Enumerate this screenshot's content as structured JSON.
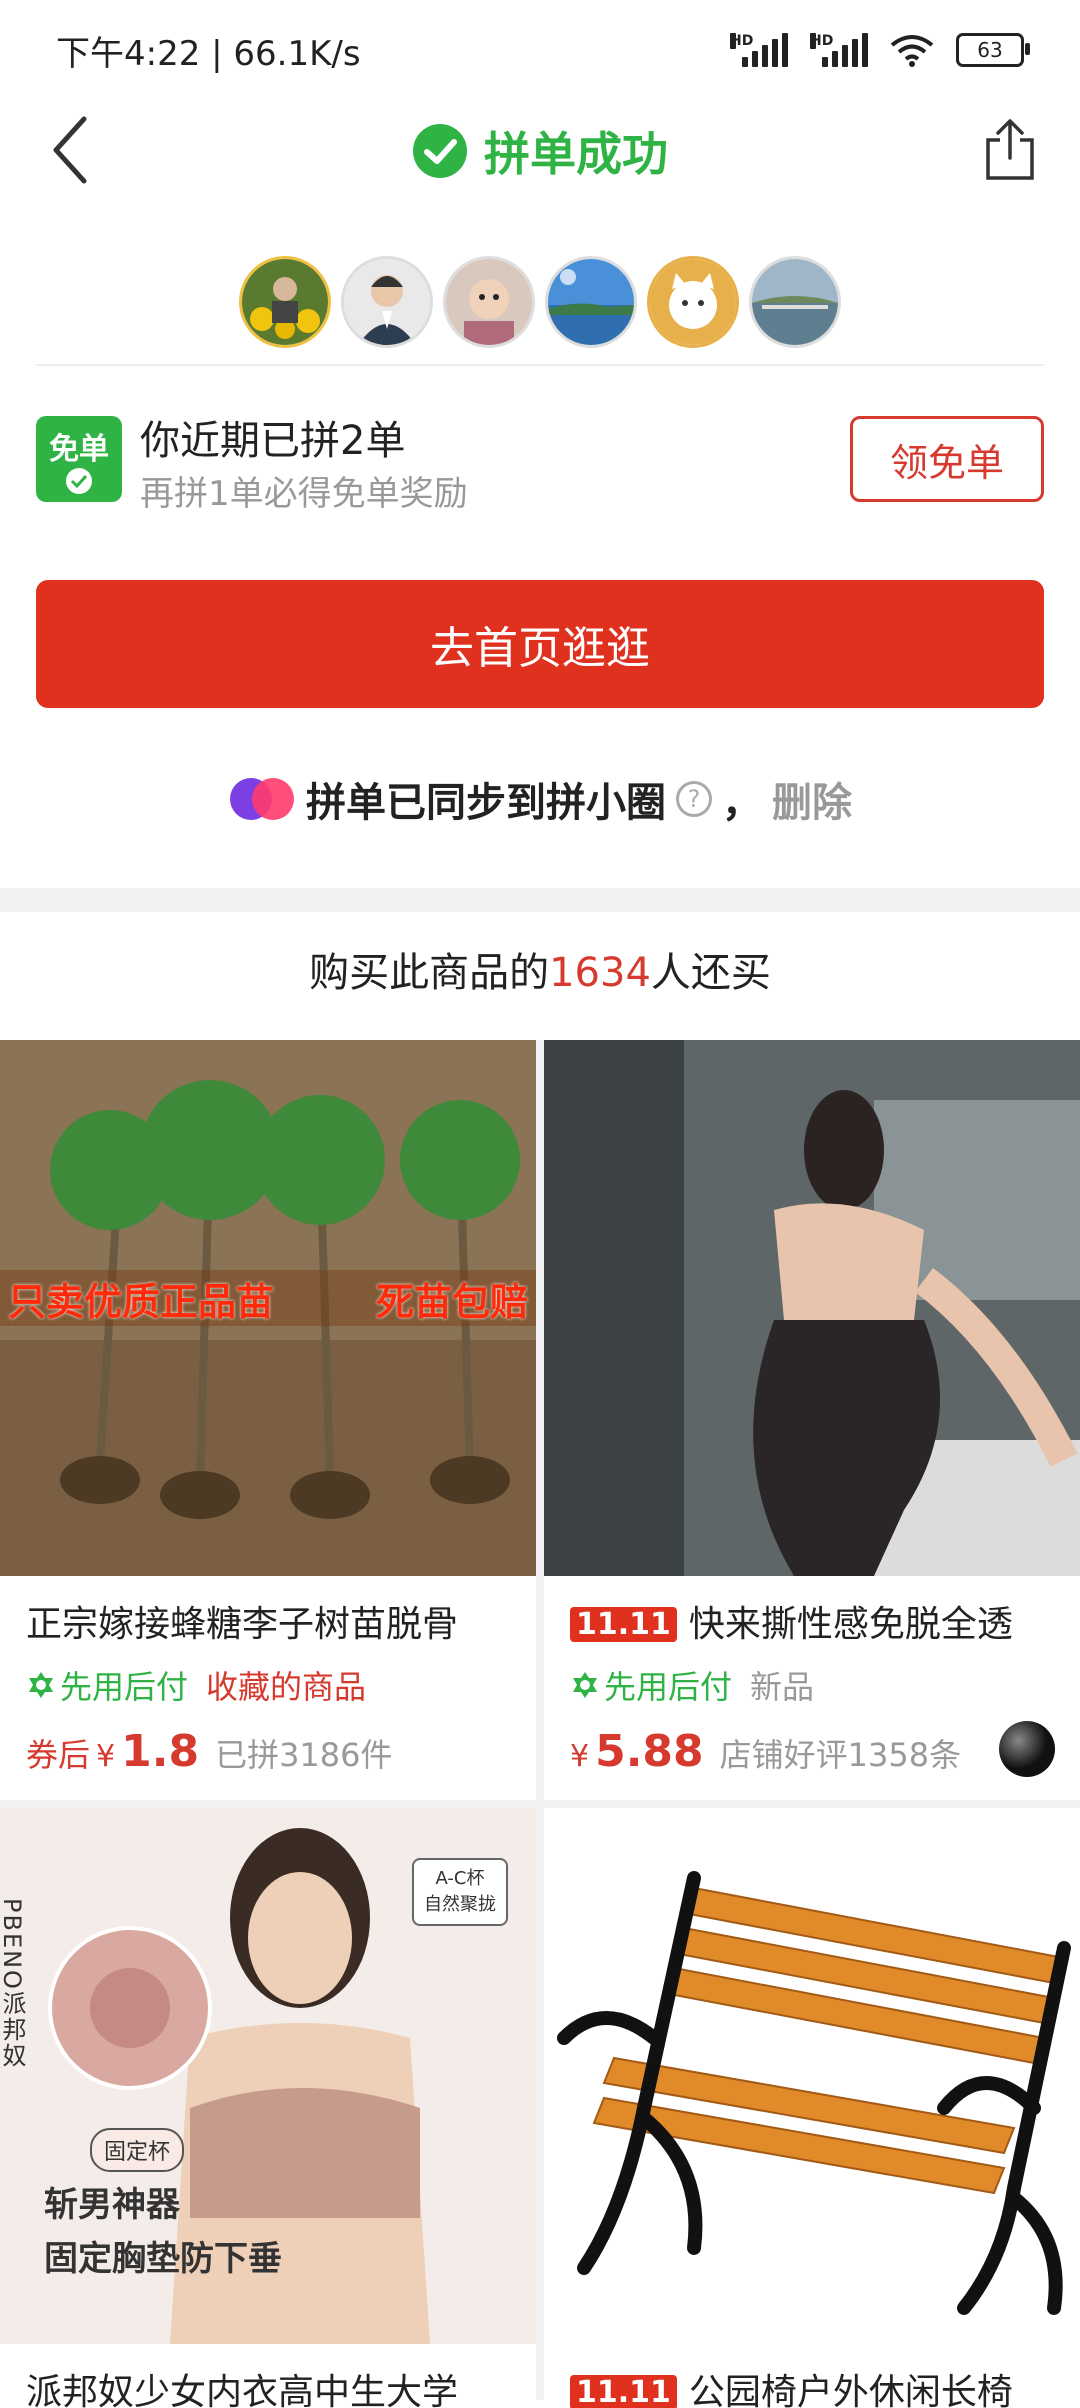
{
  "status": {
    "time_speed": "下午4:22 | 66.1K/s",
    "hd1": "HD",
    "hd2": "HD",
    "battery": "63"
  },
  "nav": {
    "title": "拼单成功",
    "accent": "#2fb344"
  },
  "free_order": {
    "icon_label": "免单",
    "title": "你近期已拼2单",
    "subtitle": "再拼1单必得免单奖励",
    "button": "领免单"
  },
  "home_button": "去首页逛逛",
  "sync": {
    "text": "拼单已同步到拼小圈",
    "help": "?",
    "separator": "，",
    "delete": "删除"
  },
  "also_bought": {
    "prefix": "购买此商品的",
    "count": "1634",
    "suffix": "人还买"
  },
  "products": [
    {
      "title": "正宗嫁接蜂糖李子树苗脱骨",
      "tag_green": "先用后付",
      "tag_second": "收藏的商品",
      "price_prefix": "券后",
      "yen": "¥",
      "price": "1.8",
      "sold": "已拼3186件",
      "banner_left": "只卖优质正品苗",
      "banner_right": "死苗包赔"
    },
    {
      "badge": "11.11",
      "title": "快来撕性感免脱全透",
      "tag_green": "先用后付",
      "tag_second": "新品",
      "yen": "¥",
      "price": "5.88",
      "sold": "店铺好评1358条"
    },
    {
      "title": "派邦奴少女内衣高中生大学",
      "brand": "PBENO派邦奴",
      "cup": "A-C杯\n自然聚拢",
      "fixed_cup": "固定杯",
      "caption1": "斩男神器",
      "caption2": "固定胸垫防下垂"
    },
    {
      "badge": "11.11",
      "title": "公园椅户外休闲长椅"
    }
  ]
}
